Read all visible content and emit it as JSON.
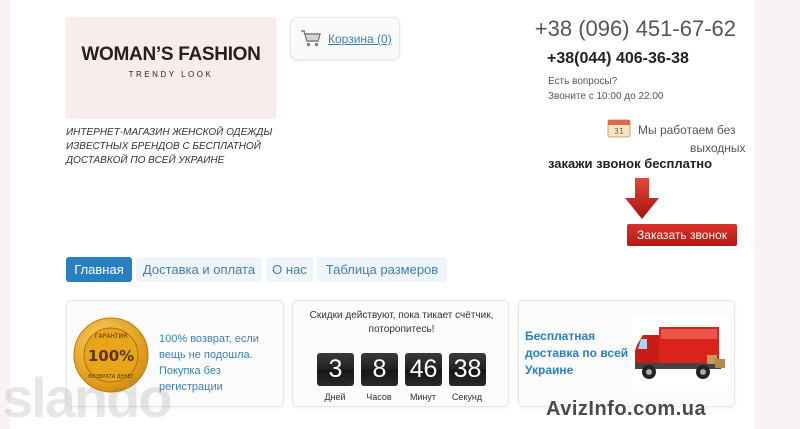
{
  "logo": {
    "title": "WOMAN’S FASHION",
    "subtitle": "TRENDY LOOK"
  },
  "tagline": "ИНТЕРНЕТ-МАГАЗИН ЖЕНСКОЙ ОДЕЖДЫ ИЗВЕСТНЫХ БРЕНДОВ С БЕСПЛАТНОЙ ДОСТАВКОЙ ПО ВСЕЙ УКРАИНЕ",
  "cart": {
    "label": "Корзина (0)",
    "icon": "cart-icon"
  },
  "contacts": {
    "phone_main": "+38 (096) 451-67-62",
    "phone_second": "+38(044) 406-36-38",
    "questions": "Есть вопросы?",
    "hours": "Звоните с 10:00 до 22:00",
    "work_line1": "Мы работаем без",
    "work_line2": "выходных",
    "callback_free": "закажи звонок бесплатно",
    "callback_button": "Заказать звонок"
  },
  "nav": {
    "tabs": [
      {
        "label": "Главная",
        "active": true
      },
      {
        "label": "Доставка и оплата",
        "active": false
      },
      {
        "label": "О нас",
        "active": false
      },
      {
        "label": "Таблица размеров",
        "active": false
      }
    ]
  },
  "features": {
    "guarantee": {
      "line1": "100% возврат, если",
      "line2": "вещь не подошла.",
      "line3": "Покупка без регистрации",
      "badge_text_top": "ГАРАНТИЯ",
      "badge_text_center": "100%",
      "badge_text_bottom": "ВОЗВРАТА ДЕНЕГ"
    },
    "countdown": {
      "title_line1": "Скидки действуют, пока тикает счётчик,",
      "title_line2": "поторопитесь!",
      "values": {
        "days": "3",
        "hours": "8",
        "minutes": "46",
        "seconds": "38"
      },
      "labels": {
        "days": "Дней",
        "hours": "Часов",
        "minutes": "Минут",
        "seconds": "Секунд"
      }
    },
    "delivery": {
      "line1": "Бесплатная",
      "line2": "доставка по всей",
      "line3": "Украине"
    }
  },
  "watermarks": {
    "left": "slando",
    "right": "AvizInfo.com.ua"
  },
  "colors": {
    "accent": "#2a7ec2",
    "button_red": "#c8241d",
    "link": "#3c7fb8"
  }
}
